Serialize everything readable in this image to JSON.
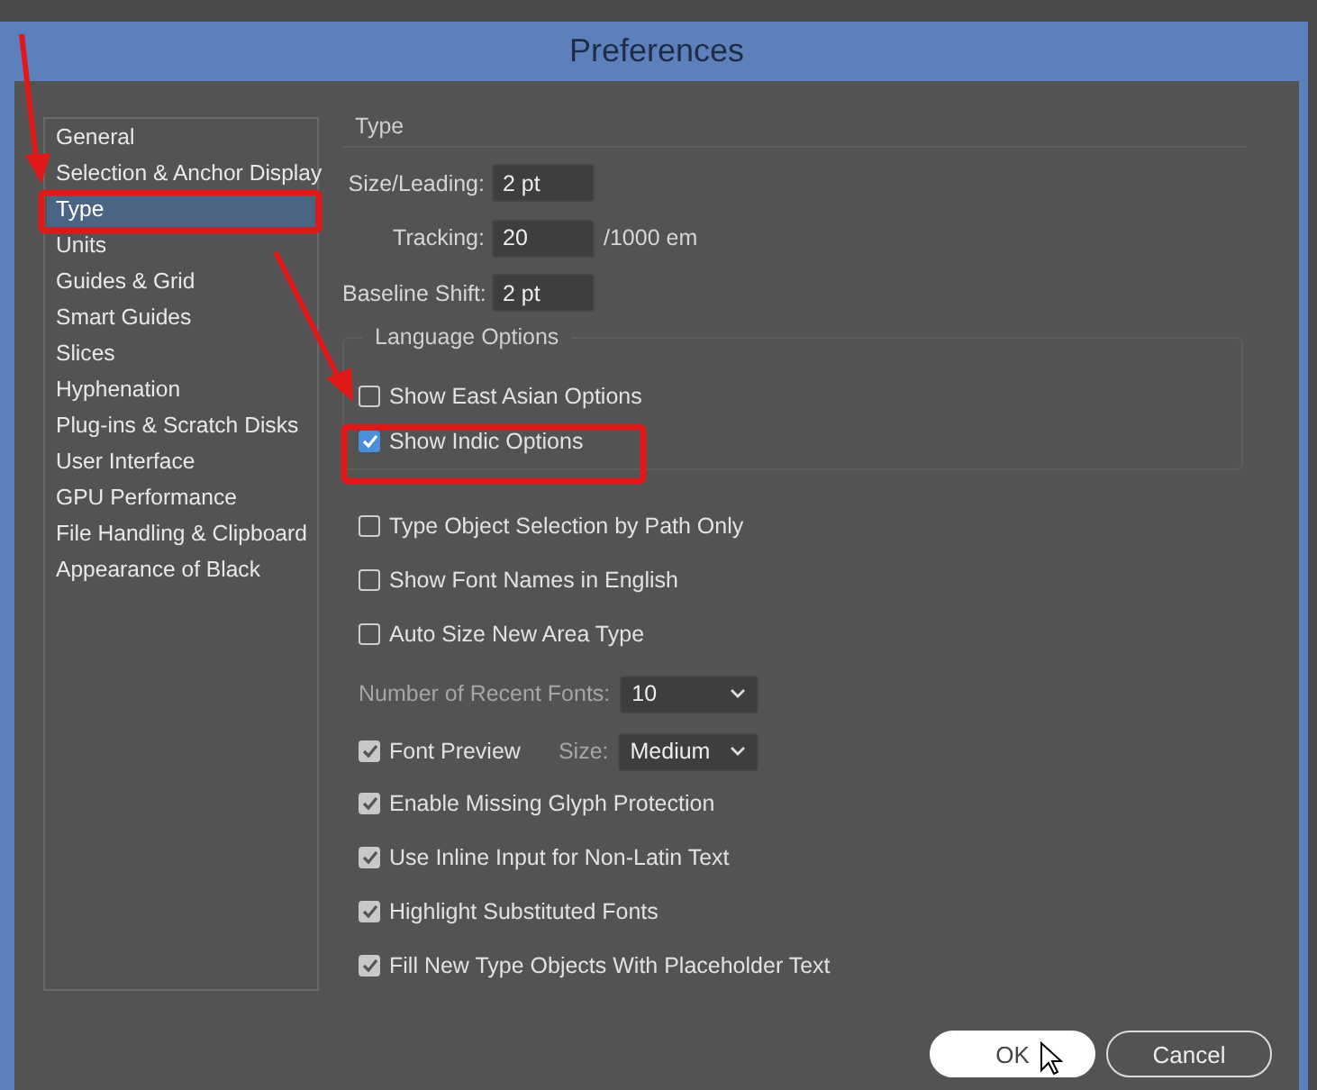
{
  "window": {
    "title": "Preferences"
  },
  "sidebar": {
    "items": [
      {
        "label": "General",
        "selected": false
      },
      {
        "label": "Selection & Anchor Display",
        "selected": false
      },
      {
        "label": "Type",
        "selected": true
      },
      {
        "label": "Units",
        "selected": false
      },
      {
        "label": "Guides & Grid",
        "selected": false
      },
      {
        "label": "Smart Guides",
        "selected": false
      },
      {
        "label": "Slices",
        "selected": false
      },
      {
        "label": "Hyphenation",
        "selected": false
      },
      {
        "label": "Plug-ins & Scratch Disks",
        "selected": false
      },
      {
        "label": "User Interface",
        "selected": false
      },
      {
        "label": "GPU Performance",
        "selected": false
      },
      {
        "label": "File Handling & Clipboard",
        "selected": false
      },
      {
        "label": "Appearance of Black",
        "selected": false
      }
    ]
  },
  "section": {
    "title": "Type"
  },
  "fields": [
    {
      "label": "Size/Leading:",
      "value": "2 pt"
    },
    {
      "label": "Tracking:",
      "value": "20",
      "unit": "/1000 em"
    },
    {
      "label": "Baseline Shift:",
      "value": "2 pt"
    }
  ],
  "language_options": {
    "title": "Language Options",
    "items": [
      {
        "label": "Show East Asian Options",
        "checked": false
      },
      {
        "label": "Show Indic Options",
        "checked": true
      }
    ]
  },
  "options": [
    {
      "kind": "checkbox",
      "label": "Type Object Selection by Path Only",
      "checked": false
    },
    {
      "kind": "checkbox",
      "label": "Show Font Names in English",
      "checked": false
    },
    {
      "kind": "checkbox",
      "label": "Auto Size New Area Type",
      "checked": false
    },
    {
      "kind": "select",
      "label": "Number of Recent Fonts:",
      "value": "10"
    },
    {
      "kind": "checkbox_select",
      "label": "Font Preview",
      "checked": true,
      "select_label": "Size:",
      "value": "Medium"
    },
    {
      "kind": "checkbox",
      "label": "Enable Missing Glyph Protection",
      "checked": true
    },
    {
      "kind": "checkbox",
      "label": "Use Inline Input for Non-Latin Text",
      "checked": true
    },
    {
      "kind": "checkbox",
      "label": "Highlight Substituted Fonts",
      "checked": true
    },
    {
      "kind": "checkbox",
      "label": "Fill New Type Objects With Placeholder Text",
      "checked": true
    }
  ],
  "buttons": [
    {
      "label": "OK",
      "kind": "primary"
    },
    {
      "label": "Cancel",
      "kind": "secondary"
    }
  ]
}
